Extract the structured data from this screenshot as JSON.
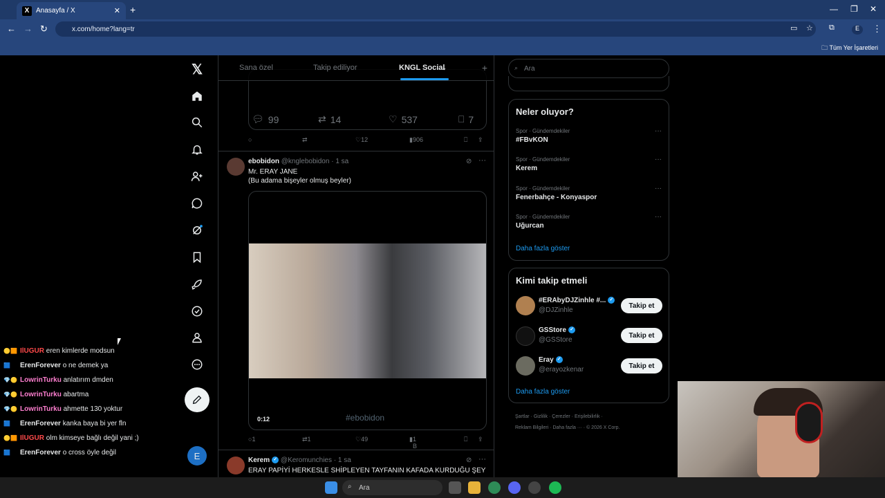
{
  "browser": {
    "tab_title": "Anasayfa / X",
    "url": "x.com/home?lang=tr",
    "bookmarks_all": "Tüm Yer İşaretleri",
    "profile_initial": "E"
  },
  "topbar": {
    "tabs": [
      {
        "label": "Sana özel"
      },
      {
        "label": "Takip ediliyor"
      },
      {
        "label": "KNGL Social"
      }
    ],
    "plus": "+"
  },
  "prev_tweet": {
    "big_stats": {
      "replies": "99",
      "retweets": "14",
      "likes": "537",
      "bookmarks": "7"
    },
    "actions": {
      "replies": "",
      "retweets": "",
      "likes": "12",
      "views": "906"
    }
  },
  "tweet1": {
    "name": "ebobidon",
    "handle": "@knglebobidon · 1 sa",
    "text_line1": "Mr. ERAY JANE",
    "text_line2": "(Bu adama bişeyler olmuş beyler)",
    "media_time": "0:12",
    "media_tag": "#ebobidon",
    "actions": {
      "replies": "1",
      "retweets": "1",
      "likes": "49",
      "views": "1 B"
    }
  },
  "tweet2": {
    "name": "Kerem",
    "handle": "@Keromunchies · 1 sa",
    "text": "ERAY PAPİYİ HERKESLE SHİPLEYEN TAYFANIN  KAFADA KURDUĞU ŞEY"
  },
  "search": {
    "placeholder": "Ara"
  },
  "trends": {
    "title": "Neler oluyor?",
    "items": [
      {
        "category": "Spor · Gündemdekiler",
        "name": "#FBvKON"
      },
      {
        "category": "Spor · Gündemdekiler",
        "name": "Kerem"
      },
      {
        "category": "Spor · Gündemdekiler",
        "name": "Fenerbahçe - Konyaspor"
      },
      {
        "category": "Spor · Gündemdekiler",
        "name": "Uğurcan"
      }
    ],
    "more": "Daha fazla göster"
  },
  "who_to_follow": {
    "title": "Kimi takip etmeli",
    "items": [
      {
        "name": "#ERAbyDJZinhle #...",
        "handle": "@DJZinhle",
        "button": "Takip et"
      },
      {
        "name": "GSStore",
        "handle": "@GSStore",
        "button": "Takip et"
      },
      {
        "name": "Eray",
        "handle": "@erayozkenar",
        "button": "Takip et"
      }
    ],
    "more": "Daha fazla göster"
  },
  "footer": {
    "line1": "Şartlar  ·  Gizlilik  ·  Çerezler  ·  Erişilebilirlik  ·",
    "line2": "Reklam Bilgileri  ·  Daha fazla ···  ·  © 2026 X Corp."
  },
  "chat": [
    {
      "user": "IlUGUR",
      "color": "#ff4a4a",
      "msg": "eren kimlerde modsun"
    },
    {
      "user": "ErenForever",
      "color": "#e7e9ea",
      "msg": "o ne demek ya"
    },
    {
      "user": "LowrinTurku",
      "color": "#ff7fd0",
      "msg": "anlatırım dmden"
    },
    {
      "user": "LowrinTurku",
      "color": "#ff7fd0",
      "msg": "abartma"
    },
    {
      "user": "LowrinTurku",
      "color": "#ff7fd0",
      "msg": "ahmette 130 yoktur"
    },
    {
      "user": "ErenForever",
      "color": "#e7e9ea",
      "msg": "kanka baya bi yer fln"
    },
    {
      "user": "IlUGUR",
      "color": "#ff4a4a",
      "msg": "olm kimseye bağlı değil yani ;)"
    },
    {
      "user": "ErenForever",
      "color": "#e7e9ea",
      "msg": "o cross öyle değil"
    }
  ],
  "taskbar": {
    "search": "Ara"
  }
}
